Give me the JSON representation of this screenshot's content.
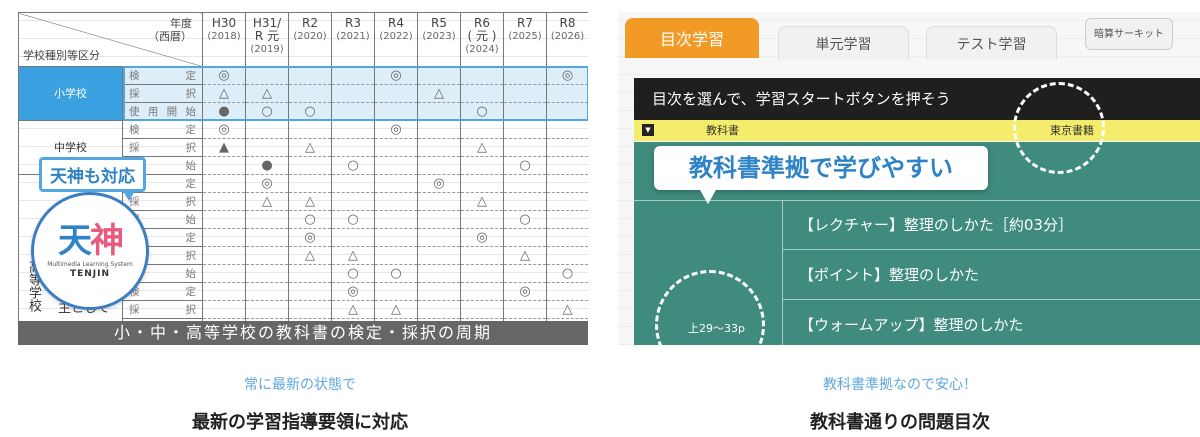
{
  "left": {
    "corner_top": "年度\n（西暦）",
    "corner_bottom": "学校種別等区分",
    "years": [
      {
        "era": "H30",
        "ad": "(2018)"
      },
      {
        "era": "H31/\nR 元",
        "ad": "(2019)"
      },
      {
        "era": "R2",
        "ad": "(2020)"
      },
      {
        "era": "R3",
        "ad": "(2021)"
      },
      {
        "era": "R4",
        "ad": "(2022)"
      },
      {
        "era": "R5",
        "ad": "(2023)"
      },
      {
        "era": "R6\n( 元 )",
        "ad": "(2024)"
      },
      {
        "era": "R7",
        "ad": "(2025)"
      },
      {
        "era": "R8",
        "ad": "(2026)"
      }
    ],
    "levels": {
      "elementary": "小学校",
      "junior": "中学校",
      "high": "高等学校",
      "high_main": "主として"
    },
    "activities": {
      "review": "検　定",
      "adopt": "採　択",
      "start": "使用開始",
      "start_short": "開始"
    },
    "marks": {
      "sho_review": [
        "◎",
        "",
        "",
        "",
        "◎",
        "",
        "",
        "",
        "◎"
      ],
      "sho_adopt": [
        "△",
        "△",
        "",
        "",
        "",
        "△",
        "",
        "",
        ""
      ],
      "sho_start": [
        "●",
        "○",
        "○",
        "",
        "",
        "",
        "○",
        "",
        ""
      ],
      "chu_review": [
        "◎",
        "",
        "",
        "",
        "◎",
        "",
        "",
        "",
        ""
      ],
      "chu_adopt": [
        "▲",
        "",
        "△",
        "",
        "",
        "",
        "△",
        "",
        ""
      ],
      "chu_start": [
        "",
        "●",
        "",
        "○",
        "",
        "",
        "",
        "○",
        ""
      ],
      "h1_review": [
        "",
        "◎",
        "",
        "",
        "",
        "◎",
        "",
        "",
        ""
      ],
      "h1_adopt": [
        "",
        "△",
        "△",
        "",
        "",
        "",
        "△",
        "",
        ""
      ],
      "h1_start": [
        "",
        "",
        "○",
        "○",
        "",
        "",
        "",
        "○",
        ""
      ],
      "h2_review": [
        "",
        "",
        "◎",
        "",
        "",
        "",
        "◎",
        "",
        ""
      ],
      "h2_adopt": [
        "",
        "",
        "△",
        "△",
        "",
        "",
        "",
        "△",
        ""
      ],
      "h2_start": [
        "",
        "",
        "",
        "○",
        "○",
        "",
        "",
        "",
        "○"
      ],
      "h3_review": [
        "",
        "",
        "",
        "◎",
        "",
        "",
        "",
        "◎",
        ""
      ],
      "h3_adopt": [
        "",
        "",
        "",
        "△",
        "△",
        "",
        "",
        "",
        "△"
      ],
      "h3_start": [
        "○",
        "",
        "",
        "",
        "○",
        "○",
        "",
        "",
        ""
      ],
      "h4_review": [
        "",
        "",
        "",
        "",
        "◎",
        "◎",
        "",
        "",
        "◎"
      ],
      "h4_adopt": [
        "△",
        "",
        "",
        "",
        "",
        "",
        "",
        "",
        ""
      ]
    },
    "banner": "小・中・高等学校の教科書の検定・採択の周期",
    "bubble": "天神も対応",
    "logo_word_1": "天",
    "logo_word_2": "神",
    "logo_sub": "Multimedia Learning System",
    "logo_name": "TENJIN"
  },
  "right": {
    "tabs": {
      "toc": "目次学習",
      "unit": "単元学習",
      "test": "テスト学習",
      "circuit": "暗算サーキット"
    },
    "instruction": "目次を選んで、学習スタートボタンを押そう",
    "subject_label": "教科書",
    "publisher": "東京書籍",
    "callout": "教科書準拠で学びやすい",
    "page_range": "上29〜33p",
    "items": [
      "【レクチャー】整理のしかた［約03分］",
      "【ポイント】整理のしかた",
      "【ウォームアップ】整理のしかた"
    ],
    "triangle": "▼"
  },
  "captions": {
    "left_sub": "常に最新の状態で",
    "left_main": "最新の学習指導要領に対応",
    "right_sub": "教科書準拠なので安心！",
    "right_main": "教科書通りの問題目次"
  }
}
